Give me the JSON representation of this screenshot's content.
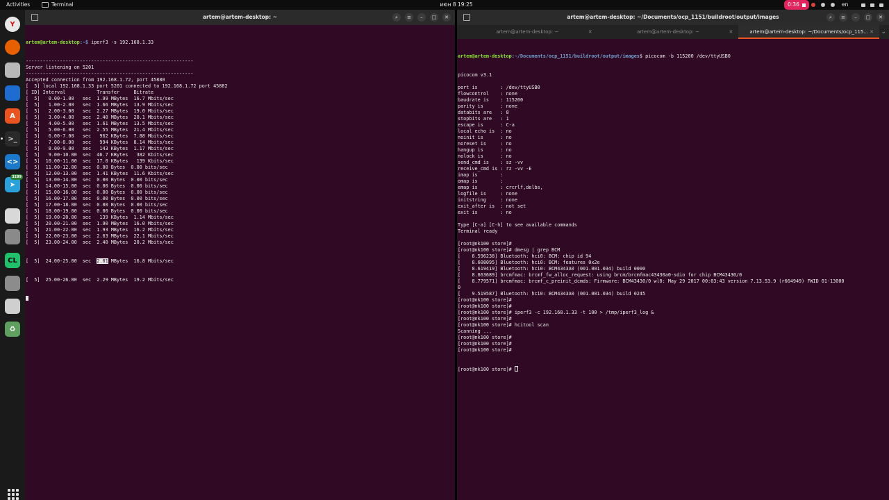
{
  "topbar": {
    "activities": "Activities",
    "app_name": "Terminal",
    "clock": "июн 8  19:25",
    "recording": "0:36",
    "language": "en"
  },
  "dock": {
    "items": [
      {
        "name": "yandex-browser",
        "glyph": "Y",
        "color": "#e8e8e8",
        "fg": "#d11"
      },
      {
        "name": "firefox",
        "glyph": "",
        "color": "#e66000",
        "fg": "#fff"
      },
      {
        "name": "files",
        "glyph": "",
        "color": "#b8b8b8",
        "fg": "#fff"
      },
      {
        "name": "libreoffice-writer",
        "glyph": "",
        "color": "#1e6cd0",
        "fg": "#fff"
      },
      {
        "name": "app-center",
        "glyph": "A",
        "color": "#e95420",
        "fg": "#fff"
      },
      {
        "name": "terminal",
        "glyph": ">_",
        "color": "#2a2a2a",
        "fg": "#ddd"
      },
      {
        "name": "vscode",
        "glyph": "<>",
        "color": "#1c78c8",
        "fg": "#fff"
      },
      {
        "name": "telegram",
        "glyph": "➤",
        "color": "#2aa1da",
        "fg": "#fff",
        "badge": "3289"
      },
      {
        "name": "text-editor",
        "glyph": "",
        "color": "#d8d8d8",
        "fg": "#333"
      },
      {
        "name": "keyboard-settings",
        "glyph": "",
        "color": "#8a8a8a",
        "fg": "#fff"
      },
      {
        "name": "clion",
        "glyph": "CL",
        "color": "#21c06a",
        "fg": "#000"
      },
      {
        "name": "ssd-drive",
        "glyph": "",
        "color": "#8c8c8c",
        "fg": "#fff"
      },
      {
        "name": "usb-drive",
        "glyph": "",
        "color": "#cfcfcf",
        "fg": "#555"
      },
      {
        "name": "trash",
        "glyph": "♻",
        "color": "#5f9f5f",
        "fg": "#fff"
      }
    ]
  },
  "left_window": {
    "title": "artem@artem-desktop: ~",
    "user_host": "artem@artem-desktop",
    "prompt_path": ":~$ ",
    "command": "iperf3 -s 192.168.1.33",
    "lines_before": [
      "-----------------------------------------------------------",
      "Server listening on 5201",
      "-----------------------------------------------------------",
      "Accepted connection from 192.168.1.72, port 45880",
      "[  5] local 192.168.1.33 port 5201 connected to 192.168.1.72 port 45882",
      "[ ID] Interval           Transfer     Bitrate",
      "[  5]   0.00-1.00   sec  1.99 MBytes  16.7 Mbits/sec",
      "[  5]   1.00-2.00   sec  1.66 MBytes  13.9 Mbits/sec",
      "[  5]   2.00-3.00   sec  2.27 MBytes  19.0 Mbits/sec",
      "[  5]   3.00-4.00   sec  2.40 MBytes  20.1 Mbits/sec",
      "[  5]   4.00-5.00   sec  1.61 MBytes  13.5 Mbits/sec",
      "[  5]   5.00-6.00   sec  2.55 MBytes  21.4 Mbits/sec",
      "[  5]   6.00-7.00   sec   962 KBytes  7.88 Mbits/sec",
      "[  5]   7.00-8.00   sec   994 KBytes  8.14 Mbits/sec",
      "[  5]   8.00-9.00   sec   143 KBytes  1.17 Mbits/sec",
      "[  5]   9.00-10.00  sec  46.7 KBytes   382 Kbits/sec",
      "[  5]  10.00-11.00  sec  17.0 KBytes   139 Kbits/sec",
      "[  5]  11.00-12.00  sec  0.00 Bytes  0.00 bits/sec",
      "[  5]  12.00-13.00  sec  1.41 KBytes  11.6 Kbits/sec",
      "[  5]  13.00-14.00  sec  0.00 Bytes  0.00 bits/sec",
      "[  5]  14.00-15.00  sec  0.00 Bytes  0.00 bits/sec",
      "[  5]  15.00-16.00  sec  0.00 Bytes  0.00 bits/sec",
      "[  5]  16.00-17.00  sec  0.00 Bytes  0.00 bits/sec",
      "[  5]  17.00-18.00  sec  0.00 Bytes  0.00 bits/sec",
      "[  5]  18.00-19.00  sec  0.00 Bytes  0.00 bits/sec",
      "[  5]  19.00-20.00  sec   139 KBytes  1.14 Mbits/sec",
      "[  5]  20.00-21.00  sec  1.90 MBytes  16.0 Mbits/sec",
      "[  5]  21.00-22.00  sec  1.93 MBytes  16.2 Mbits/sec",
      "[  5]  22.00-23.00  sec  2.63 MBytes  22.1 Mbits/sec",
      "[  5]  23.00-24.00  sec  2.40 MBytes  20.2 Mbits/sec"
    ],
    "sel_line": {
      "pre": "[  5]  24.00-25.00  sec  ",
      "sel": "2.01",
      "post": " MBytes  16.8 Mbits/sec"
    },
    "lines_after": [
      "[  5]  25.00-26.00  sec  2.29 MBytes  19.2 Mbits/sec"
    ]
  },
  "right_window": {
    "title": "artem@artem-desktop: ~/Documents/ocp_1151/buildroot/output/images",
    "tabs": [
      "artem@artem-desktop: ~",
      "artem@artem-desktop: ~",
      "artem@artem-desktop: ~/Documents/ocp_115..."
    ],
    "user_host": "artem@artem-desktop",
    "prompt_path": ":~/Documents/ocp_1151/buildroot/output/images",
    "command": "$ picocom -b 115200 /dev/ttyUSB0",
    "lines": [
      "picocom v3.1",
      "",
      "port is        : /dev/ttyUSB0",
      "flowcontrol    : none",
      "baudrate is    : 115200",
      "parity is      : none",
      "databits are   : 8",
      "stopbits are   : 1",
      "escape is      : C-a",
      "local echo is  : no",
      "noinit is      : no",
      "noreset is     : no",
      "hangup is      : no",
      "nolock is      : no",
      "send_cmd is    : sz -vv",
      "receive_cmd is : rz -vv -E",
      "imap is        : ",
      "omap is        : ",
      "emap is        : crcrlf,delbs,",
      "logfile is     : none",
      "initstring     : none",
      "exit_after is  : not set",
      "exit is        : no",
      "",
      "Type [C-a] [C-h] to see available commands",
      "Terminal ready",
      "",
      "[root@nk100 store]#",
      "[root@nk100 store]# dmesg | grep BCM",
      "[    8.596238] Bluetooth: hci0: BCM: chip id 94",
      "[    8.608095] Bluetooth: hci0: BCM: features 0x2e",
      "[    8.619419] Bluetooth: hci0: BCM4343A0 (001.001.034) build 0000",
      "[    8.663689] brcmfmac: brcmf_fw_alloc_request: using brcm/brcmfmac43430a0-sdio for chip BCM43430/0",
      "[    8.779571] brcmfmac: brcmf_c_preinit_dcmds: Firmware: BCM43430/0 wl0: May 29 2017 00:03:43 version 7.13.53.9 (r664949) FWID 01-13000",
      "0",
      "[    9.519587] Bluetooth: hci0: BCM4343A0 (001.001.034) build 0245",
      "[root@nk100 store]#",
      "[root@nk100 store]#",
      "[root@nk100 store]# iperf3 -c 192.168.1.33 -t 100 > /tmp/iperf3_log &",
      "[root@nk100 store]#",
      "[root@nk100 store]# hcitool scan",
      "Scanning ...",
      "[root@nk100 store]#",
      "[root@nk100 store]#",
      "[root@nk100 store]#"
    ],
    "last_prompt": "[root@nk100 store]# "
  }
}
